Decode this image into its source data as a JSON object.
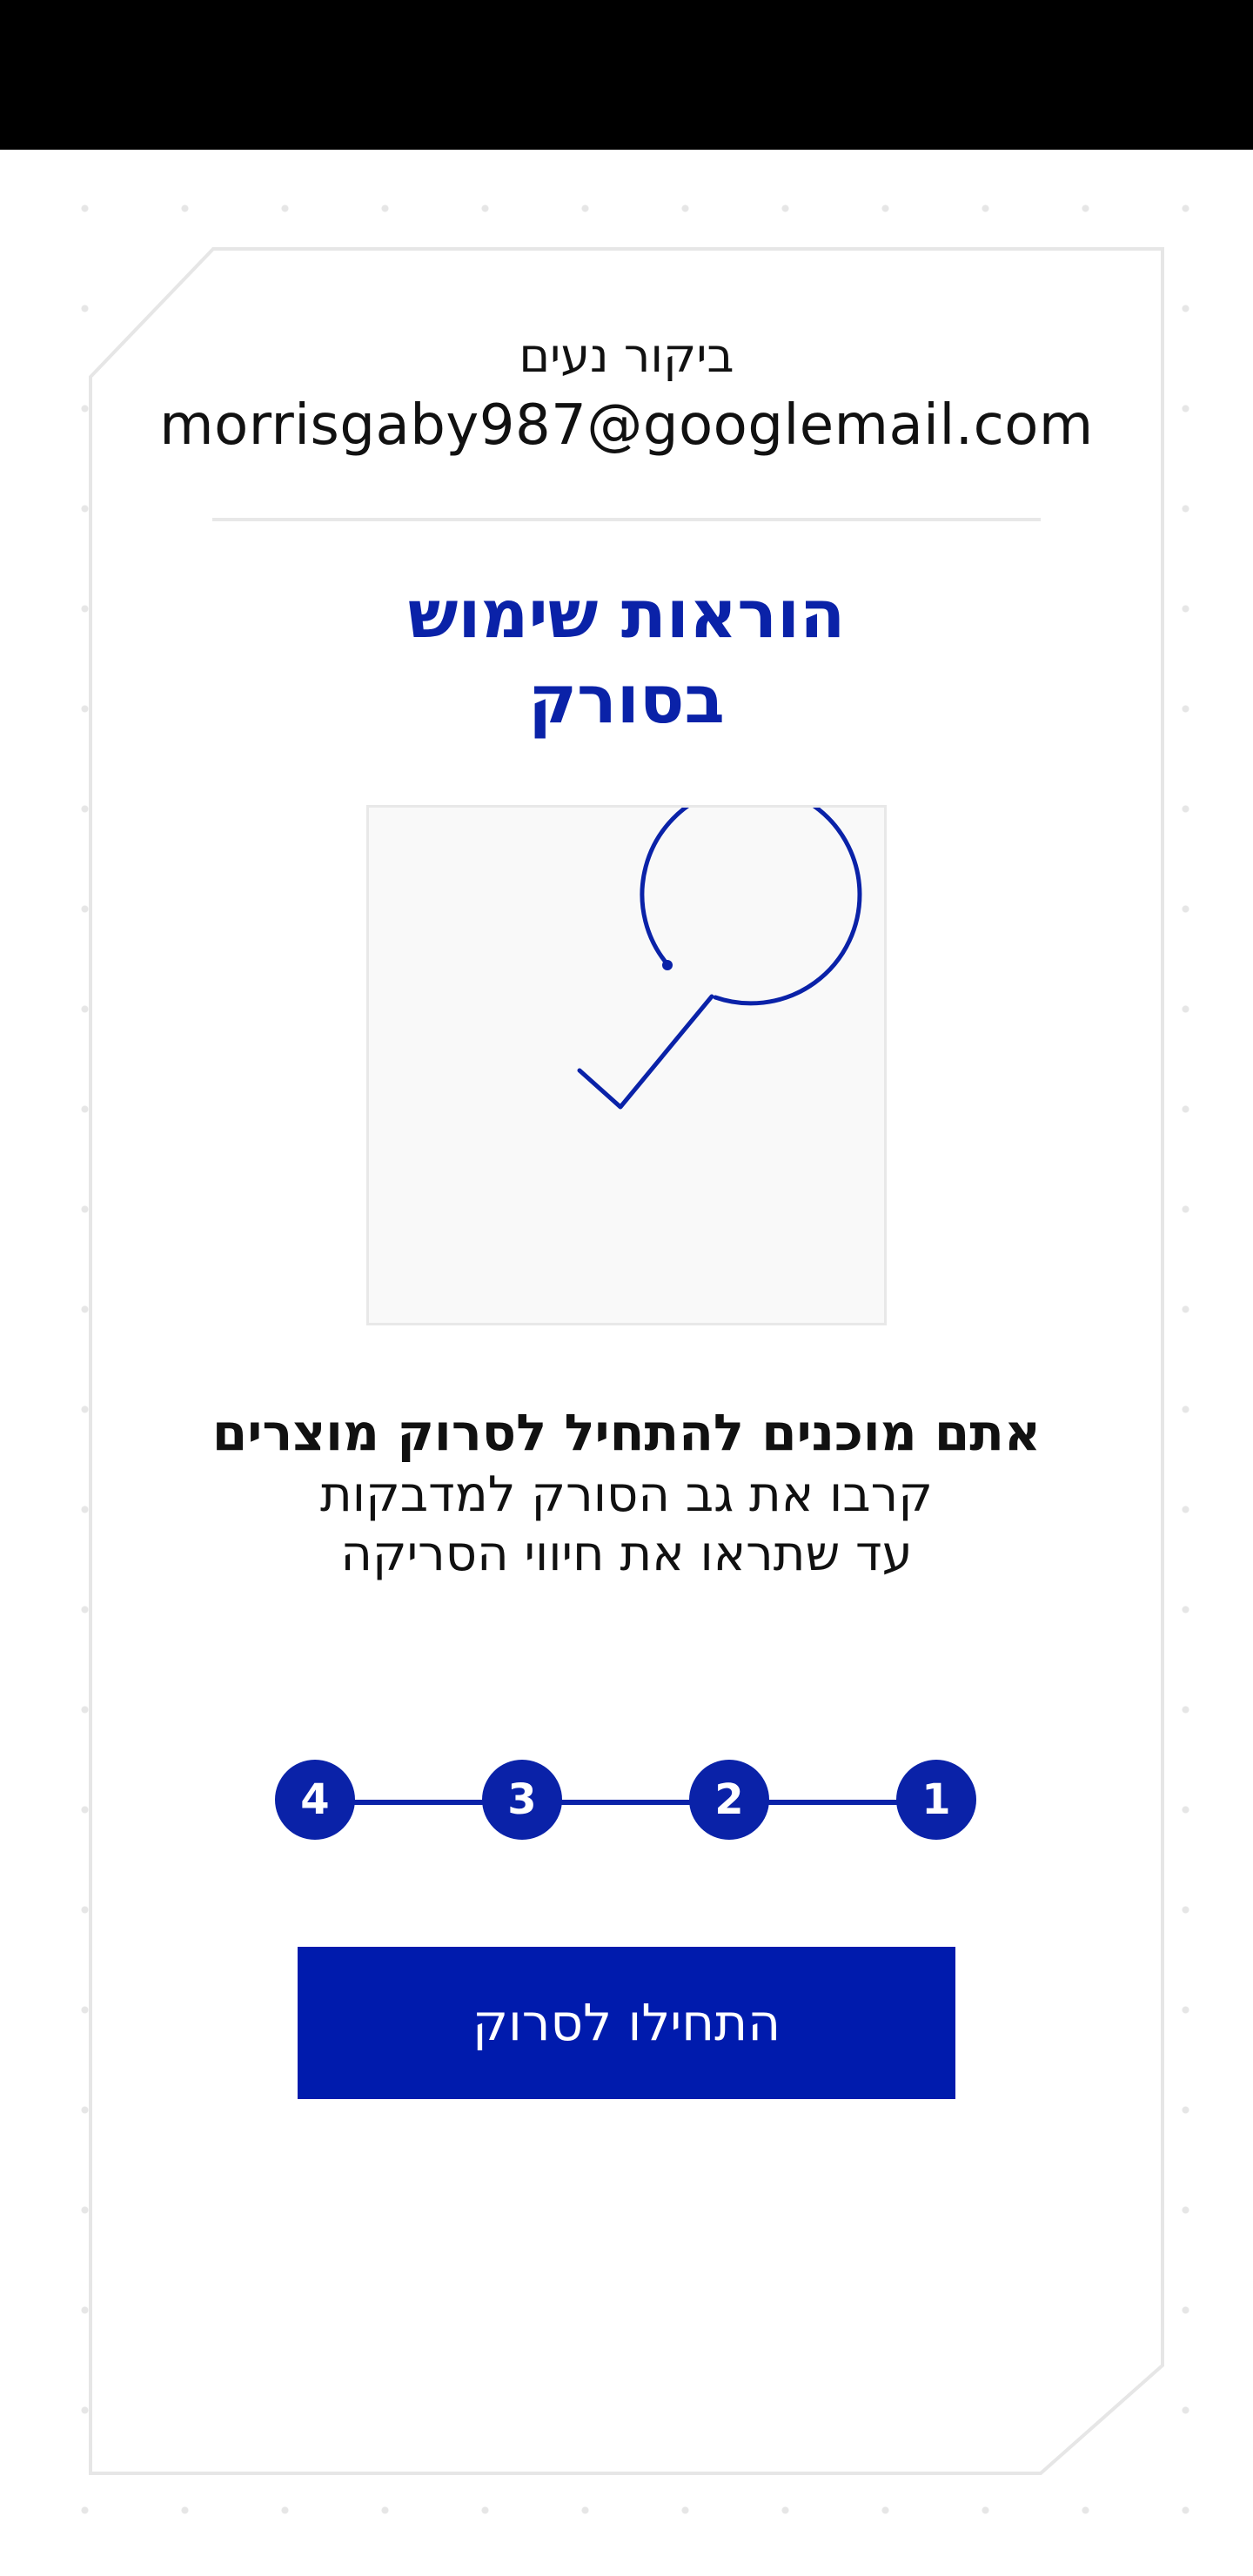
{
  "user": {
    "name": "ביקור נעים",
    "email": "morrisgaby987@googlemail.com"
  },
  "instructions": {
    "title_line1": "הוראות שימוש",
    "title_line2": "בסורק",
    "illustration_icon": "check-circle-icon",
    "heading": "אתם מוכנים להתחיל לסרוק מוצרים",
    "body": "קרבו את גב הסורק למדבקות עד שתראו את חיווי הסריקה"
  },
  "stepper": {
    "steps": [
      "1",
      "2",
      "3",
      "4"
    ],
    "current": 1
  },
  "actions": {
    "start_label": "התחילו לסרוק"
  },
  "colors": {
    "accent": "#0a22a8",
    "button": "#001bad",
    "status_bar": "#000000"
  }
}
